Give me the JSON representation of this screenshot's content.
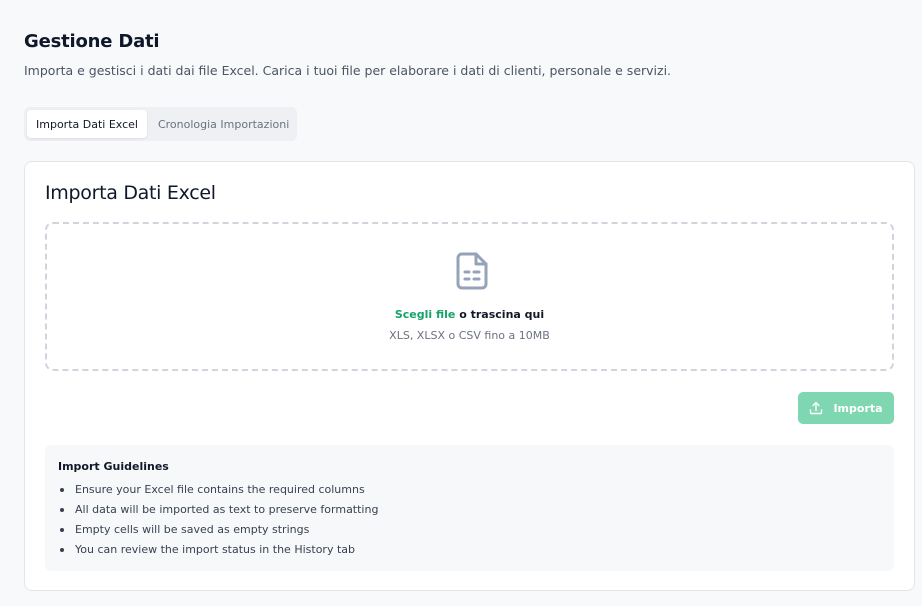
{
  "page": {
    "title": "Gestione Dati",
    "subtitle": "Importa e gestisci i dati dai file Excel. Carica i tuoi file per elaborare i dati di clienti, personale e servizi."
  },
  "tabs": [
    {
      "label": "Importa Dati Excel",
      "active": true
    },
    {
      "label": "Cronologia Importazioni",
      "active": false
    }
  ],
  "card": {
    "title": "Importa Dati Excel",
    "dropzone": {
      "icon": "file-spreadsheet-icon",
      "choose_label": "Scegli file",
      "drag_label": " o trascina qui",
      "hint": "XLS, XLSX o CSV fino a 10MB"
    },
    "import_button": {
      "label": "Importa",
      "icon": "upload-icon",
      "state": "disabled"
    },
    "guidelines": {
      "title": "Import Guidelines",
      "items": [
        "Ensure your Excel file contains the required columns",
        "All data will be imported as text to preserve formatting",
        "Empty cells will be saved as empty strings",
        "You can review the import status in the History tab"
      ]
    }
  },
  "colors": {
    "accent": "#16a36a",
    "button_disabled": "#7fd7b1",
    "page_background": "#f8f9fb"
  }
}
